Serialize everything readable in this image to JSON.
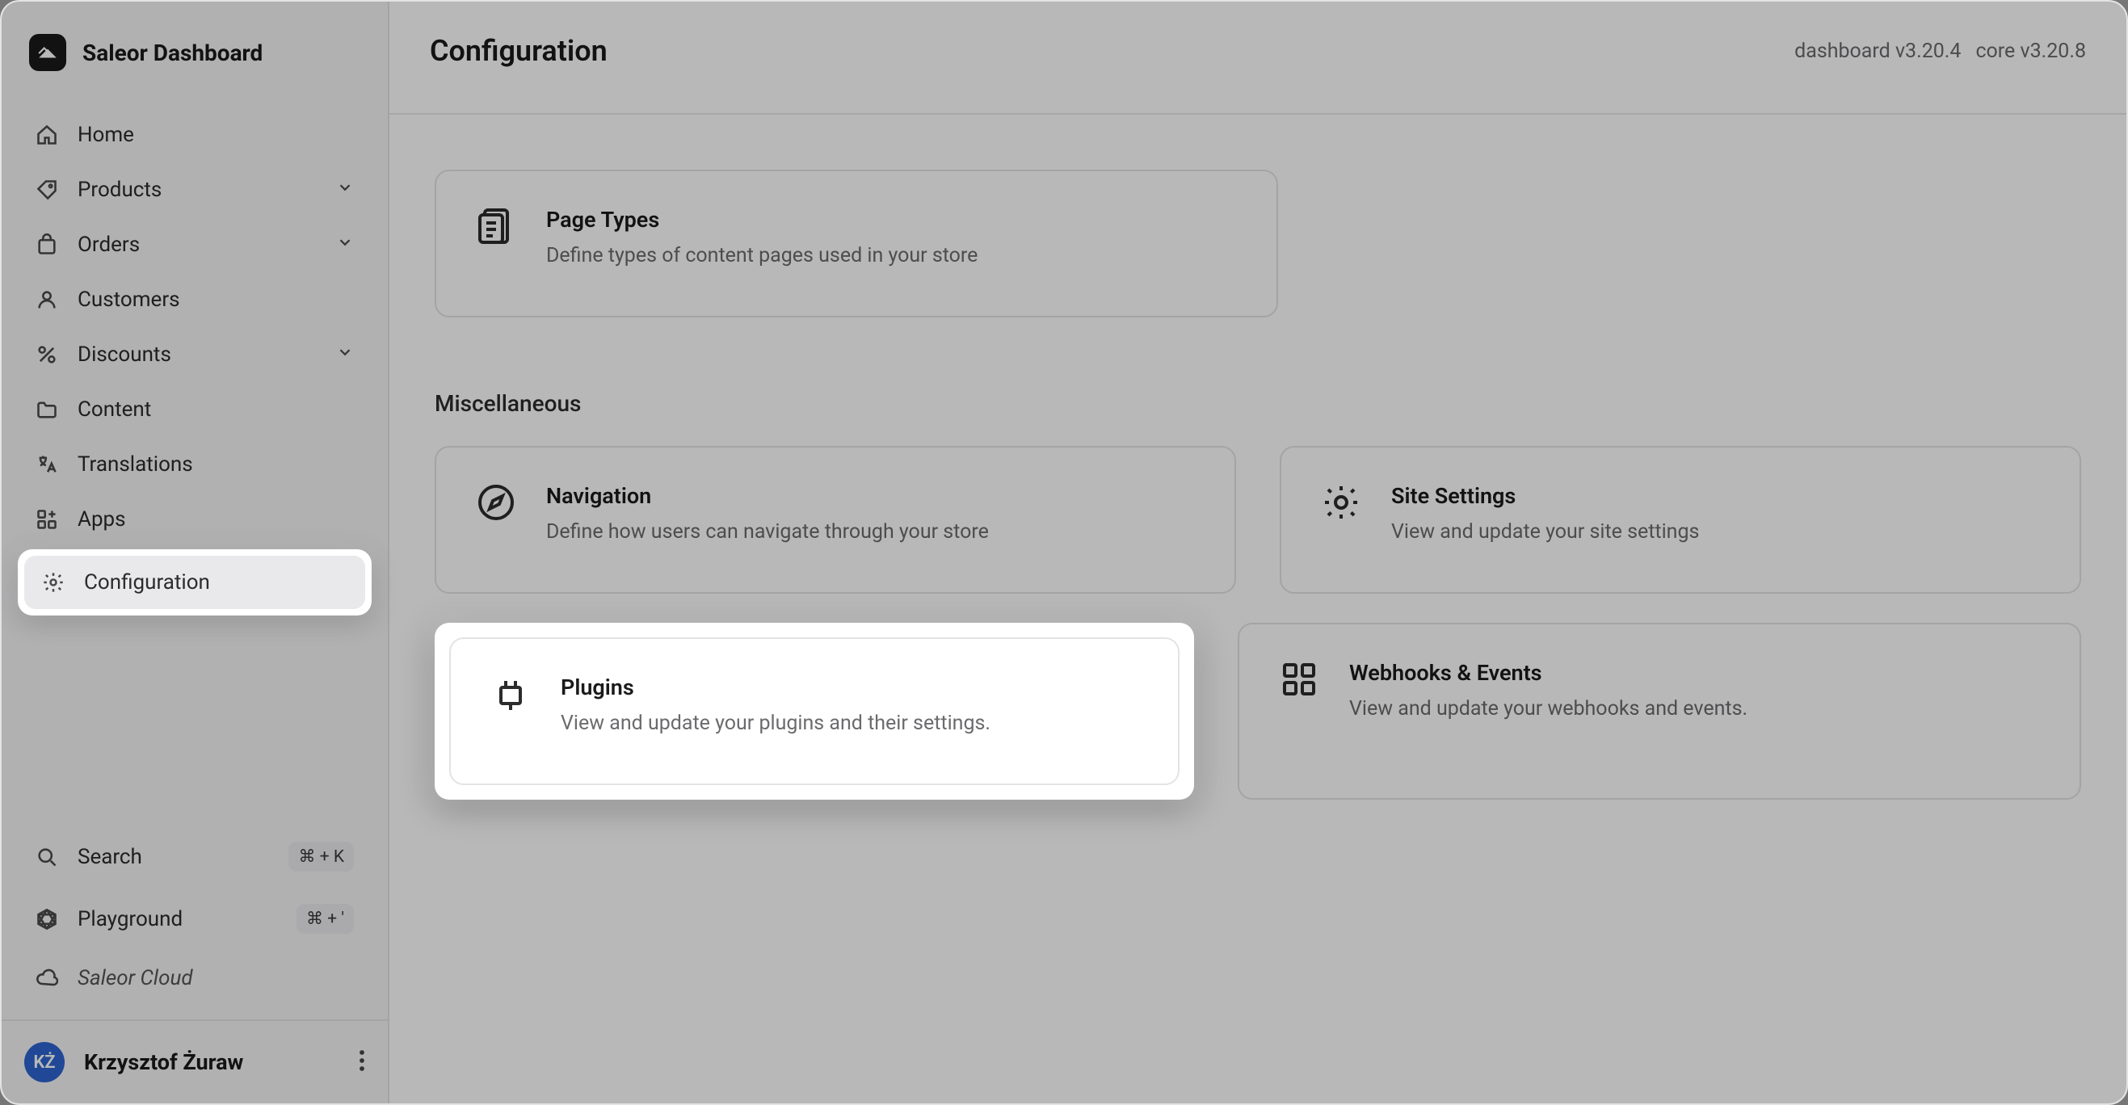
{
  "brand": {
    "name": "Saleor Dashboard"
  },
  "sidebar": {
    "items": [
      {
        "label": "Home"
      },
      {
        "label": "Products"
      },
      {
        "label": "Orders"
      },
      {
        "label": "Customers"
      },
      {
        "label": "Discounts"
      },
      {
        "label": "Content"
      },
      {
        "label": "Translations"
      },
      {
        "label": "Apps"
      },
      {
        "label": "Configuration"
      }
    ],
    "search": {
      "label": "Search",
      "kbd": "⌘ + K"
    },
    "playground": {
      "label": "Playground",
      "kbd": "⌘ + '"
    },
    "cloud": {
      "label": "Saleor Cloud"
    }
  },
  "user": {
    "initials": "KŻ",
    "name": "Krzysztof Żuraw"
  },
  "header": {
    "title": "Configuration",
    "version_dashboard": "dashboard v3.20.4",
    "version_core": "core v3.20.8"
  },
  "cards": {
    "page_types": {
      "title": "Page Types",
      "desc": "Define types of content pages used in your store"
    },
    "misc_heading": "Miscellaneous",
    "navigation": {
      "title": "Navigation",
      "desc": "Define how users can navigate through your store"
    },
    "site_settings": {
      "title": "Site Settings",
      "desc": "View and update your site settings"
    },
    "plugins": {
      "title": "Plugins",
      "desc": "View and update your plugins and their settings."
    },
    "webhooks": {
      "title": "Webhooks & Events",
      "desc": "View and update your webhooks and events."
    }
  }
}
